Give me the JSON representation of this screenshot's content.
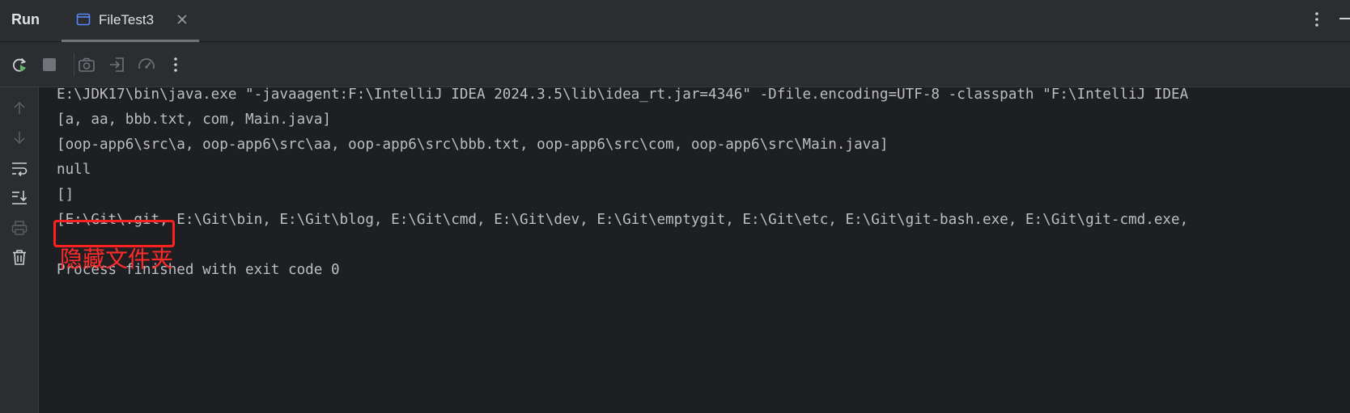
{
  "panel": {
    "title": "Run"
  },
  "tabs": [
    {
      "label": "FileTest3",
      "active": true
    }
  ],
  "toolbar": {
    "icons": [
      "rerun-icon",
      "stop-icon",
      "camera-icon",
      "login-icon",
      "performance-icon",
      "more-vertical-icon"
    ]
  },
  "gutter": {
    "icons": [
      "arrow-up-icon",
      "arrow-down-icon",
      "soft-wrap-icon",
      "scroll-to-end-icon",
      "print-icon",
      "trash-icon"
    ]
  },
  "console": {
    "lines": [
      "E:\\JDK17\\bin\\java.exe \"-javaagent:F:\\IntelliJ IDEA 2024.3.5\\lib\\idea_rt.jar=4346\" -Dfile.encoding=UTF-8 -classpath \"F:\\IntelliJ IDEA",
      "[a, aa, bbb.txt, com, Main.java]",
      "[oop-app6\\src\\a, oop-app6\\src\\aa, oop-app6\\src\\bbb.txt, oop-app6\\src\\com, oop-app6\\src\\Main.java]",
      "null",
      "[]",
      "[E:\\Git\\.git, E:\\Git\\bin, E:\\Git\\blog, E:\\Git\\cmd, E:\\Git\\dev, E:\\Git\\emptygit, E:\\Git\\etc, E:\\Git\\git-bash.exe, E:\\Git\\git-cmd.exe,",
      "Process finished with exit code 0"
    ]
  },
  "annotation": {
    "text": "隐藏文件夹",
    "color": "#ff2020"
  },
  "colors": {
    "background": "#1e1f22",
    "panel": "#2b2d30",
    "text": "#bcbec4",
    "accent": "#3574f0",
    "rerun_green": "#5fb865"
  }
}
